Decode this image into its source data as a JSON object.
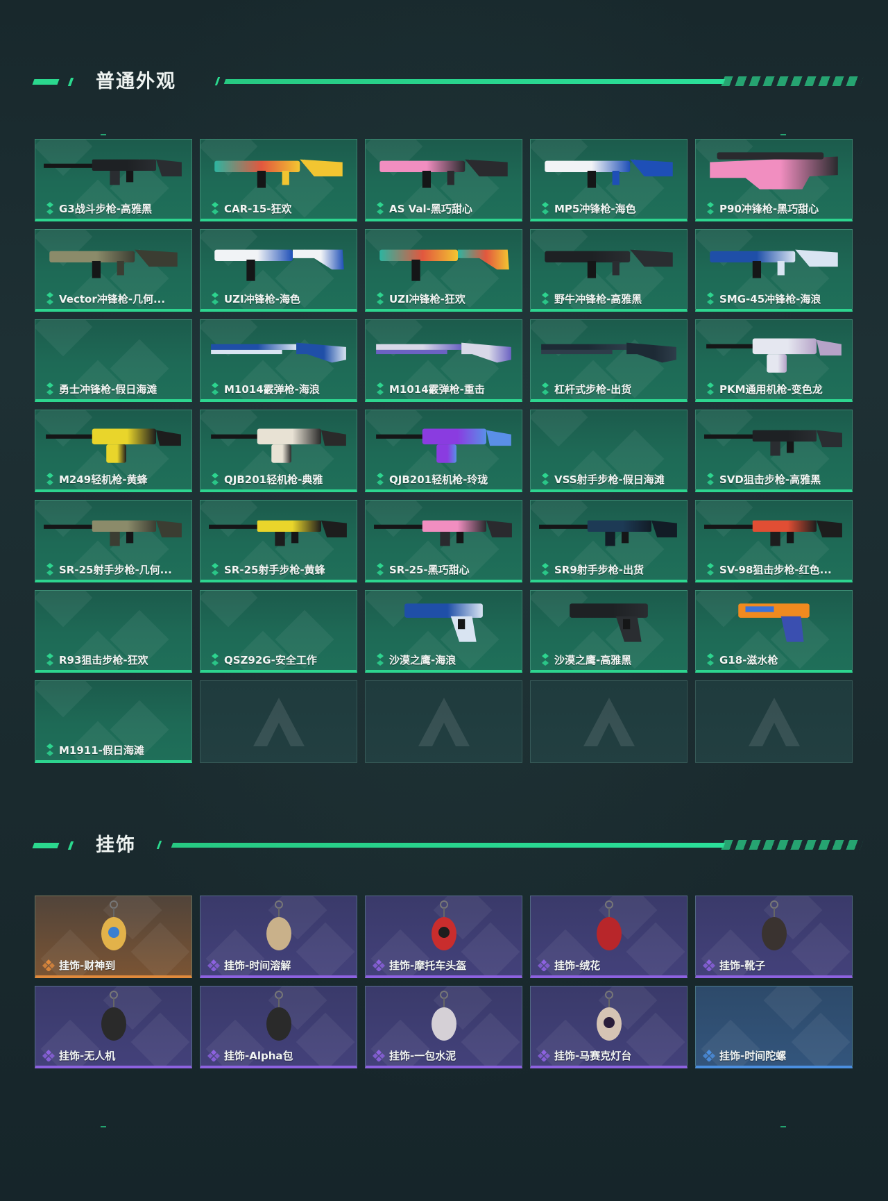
{
  "sections": {
    "skins": {
      "title": "普通外观",
      "items": [
        {
          "label": "G3战斗步枪-高雅黑",
          "rarity": "green",
          "weapon": "rifle",
          "colors": [
            "#1e2124",
            "#2a2d31"
          ]
        },
        {
          "label": "CAR-15-狂欢",
          "rarity": "green",
          "weapon": "carbine",
          "colors": [
            "#2db4a0",
            "#f2c531",
            "#e2573e"
          ]
        },
        {
          "label": "AS Val-黑巧甜心",
          "rarity": "green",
          "weapon": "asval",
          "colors": [
            "#f18ec0",
            "#2a2a2e"
          ]
        },
        {
          "label": "MP5冲锋枪-海色",
          "rarity": "green",
          "weapon": "smg",
          "colors": [
            "#f1f3f6",
            "#1e4fb7"
          ]
        },
        {
          "label": "P90冲锋枪-黑巧甜心",
          "rarity": "green",
          "weapon": "p90",
          "colors": [
            "#f18ec0",
            "#2a2a2e"
          ]
        },
        {
          "label": "Vector冲锋枪-几何...",
          "rarity": "green",
          "weapon": "vector",
          "colors": [
            "#8b8b6a",
            "#3b3d32"
          ]
        },
        {
          "label": "UZI冲锋枪-海色",
          "rarity": "green",
          "weapon": "uzi",
          "colors": [
            "#f1f3f6",
            "#1e4fb7"
          ]
        },
        {
          "label": "UZI冲锋枪-狂欢",
          "rarity": "green",
          "weapon": "uzi",
          "colors": [
            "#2db4a0",
            "#f2c531",
            "#e2573e"
          ]
        },
        {
          "label": "野牛冲锋枪-高雅黑",
          "rarity": "green",
          "weapon": "bizon",
          "colors": [
            "#1e2124",
            "#2a2d31"
          ]
        },
        {
          "label": "SMG-45冲锋枪-海浪",
          "rarity": "green",
          "weapon": "smg45",
          "colors": [
            "#1f4fa8",
            "#d9e4f2"
          ]
        },
        {
          "label": "勇士冲锋枪-假日海滩",
          "rarity": "green",
          "weapon": "none",
          "colors": []
        },
        {
          "label": "M1014霰弹枪-海浪",
          "rarity": "green",
          "weapon": "shotgun",
          "colors": [
            "#1f4fa8",
            "#d9e4f2"
          ]
        },
        {
          "label": "M1014霰弹枪-重击",
          "rarity": "green",
          "weapon": "shotgun",
          "colors": [
            "#d8d8e8",
            "#6b62c2"
          ]
        },
        {
          "label": "杠杆式步枪-出货",
          "rarity": "green",
          "weapon": "lever",
          "colors": [
            "#1d2a35",
            "#2e3d4a"
          ]
        },
        {
          "label": "PKM通用机枪-变色龙",
          "rarity": "green",
          "weapon": "pkm",
          "colors": [
            "#e5e7f0",
            "#b6a3c8"
          ]
        },
        {
          "label": "M249轻机枪-黄蜂",
          "rarity": "green",
          "weapon": "m249",
          "colors": [
            "#e9d52b",
            "#1d1d1d"
          ]
        },
        {
          "label": "QJB201轻机枪-典雅",
          "rarity": "green",
          "weapon": "qjb",
          "colors": [
            "#e8e2d4",
            "#2a2a2a"
          ]
        },
        {
          "label": "QJB201轻机枪-玲珑",
          "rarity": "green",
          "weapon": "qjb",
          "colors": [
            "#8a3ce0",
            "#5a8fe8"
          ]
        },
        {
          "label": "VSS射手步枪-假日海滩",
          "rarity": "green",
          "weapon": "none",
          "colors": []
        },
        {
          "label": "SVD狙击步枪-高雅黑",
          "rarity": "green",
          "weapon": "svd",
          "colors": [
            "#1e2124",
            "#2a2d31"
          ]
        },
        {
          "label": "SR-25射手步枪-几何...",
          "rarity": "green",
          "weapon": "sr25",
          "colors": [
            "#8b8b6a",
            "#3b3d32"
          ]
        },
        {
          "label": "SR-25射手步枪-黄蜂",
          "rarity": "green",
          "weapon": "sr25",
          "colors": [
            "#e9d52b",
            "#1d1d1d"
          ]
        },
        {
          "label": "SR-25-黑巧甜心",
          "rarity": "green",
          "weapon": "sr25",
          "colors": [
            "#f18ec0",
            "#2a2a2e"
          ]
        },
        {
          "label": "SR9射手步枪-出货",
          "rarity": "green",
          "weapon": "sr9",
          "colors": [
            "#1d3a55",
            "#121c26"
          ]
        },
        {
          "label": "SV-98狙击步枪-红色...",
          "rarity": "green",
          "weapon": "sv98",
          "colors": [
            "#e14e34",
            "#1d1d1d"
          ]
        },
        {
          "label": "R93狙击步枪-狂欢",
          "rarity": "green",
          "weapon": "none",
          "colors": []
        },
        {
          "label": "QSZ92G-安全工作",
          "rarity": "green",
          "weapon": "none",
          "colors": []
        },
        {
          "label": "沙漠之鹰-海浪",
          "rarity": "green",
          "weapon": "pistol",
          "colors": [
            "#1f4fa8",
            "#d9e4f2"
          ]
        },
        {
          "label": "沙漠之鹰-高雅黑",
          "rarity": "green",
          "weapon": "pistol",
          "colors": [
            "#1e2124",
            "#2a2d31"
          ]
        },
        {
          "label": "G18-滋水枪",
          "rarity": "green",
          "weapon": "glock",
          "colors": [
            "#f08a1f",
            "#3a4fb0"
          ]
        },
        {
          "label": "M1911-假日海滩",
          "rarity": "green",
          "weapon": "none",
          "colors": []
        },
        {
          "label": "",
          "rarity": "empty",
          "weapon": "none",
          "colors": []
        },
        {
          "label": "",
          "rarity": "empty",
          "weapon": "none",
          "colors": []
        },
        {
          "label": "",
          "rarity": "empty",
          "weapon": "none",
          "colors": []
        },
        {
          "label": "",
          "rarity": "empty",
          "weapon": "none",
          "colors": []
        }
      ]
    },
    "charms": {
      "title": "挂饰",
      "items": [
        {
          "label": "挂饰-财神到",
          "rarity": "orange",
          "icon": "fortune-god-icon",
          "colors": [
            "#e2b24a",
            "#3a7fd0"
          ]
        },
        {
          "label": "挂饰-时间溶解",
          "rarity": "purple",
          "icon": "melting-clock-icon",
          "colors": [
            "#c9b18a"
          ]
        },
        {
          "label": "挂饰-摩托车头盔",
          "rarity": "purple",
          "icon": "helmet-icon",
          "colors": [
            "#c92d2d",
            "#1d1d1d"
          ]
        },
        {
          "label": "挂饰-绒花",
          "rarity": "purple",
          "icon": "velvet-flower-icon",
          "colors": [
            "#b8262a"
          ]
        },
        {
          "label": "挂饰-靴子",
          "rarity": "purple",
          "icon": "boot-icon",
          "colors": [
            "#3a3330"
          ]
        },
        {
          "label": "挂饰-无人机",
          "rarity": "purple",
          "icon": "drone-icon",
          "colors": [
            "#2a2a2a"
          ]
        },
        {
          "label": "挂饰-Alpha包",
          "rarity": "purple",
          "icon": "alpha-bag-icon",
          "colors": [
            "#2a2a2a"
          ]
        },
        {
          "label": "挂饰-一包水泥",
          "rarity": "purple",
          "icon": "cement-bag-icon",
          "colors": [
            "#d5d0d6"
          ]
        },
        {
          "label": "挂饰-马赛克灯台",
          "rarity": "purple",
          "icon": "mosaic-lamp-icon",
          "colors": [
            "#d6c4b4",
            "#2a1d3a"
          ]
        },
        {
          "label": "挂饰-时间陀螺",
          "rarity": "blue",
          "icon": "none",
          "colors": []
        }
      ]
    }
  },
  "rarity_colors": {
    "green": "#2dd58f",
    "purple": "#8d62e0",
    "orange": "#e08a3c",
    "blue": "#4b8fe0"
  }
}
